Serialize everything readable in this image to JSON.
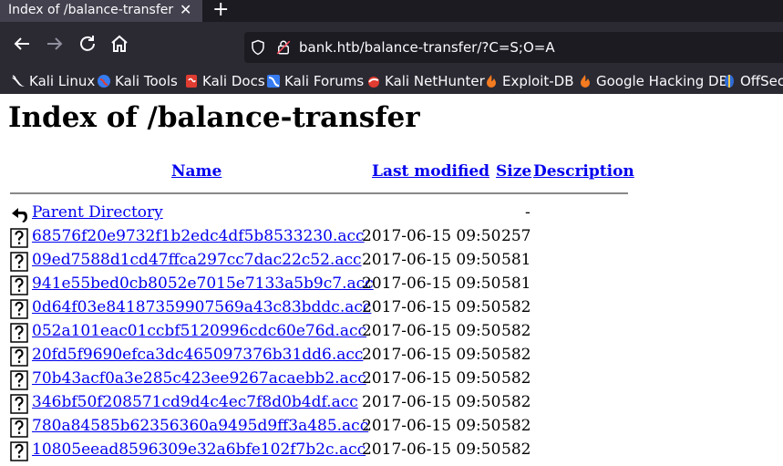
{
  "tab": {
    "title": "Index of /balance-transfer",
    "close_glyph": "✕",
    "new_tab_glyph": "+"
  },
  "nav": {
    "url": "bank.htb/balance-transfer/?C=S;O=A",
    "icons": [
      "back-icon",
      "forward-icon",
      "reload-icon",
      "home-icon",
      "shield-icon",
      "lock-icon"
    ]
  },
  "bookmarks": [
    {
      "label": "Kali Linux",
      "icon": "kali-dragon-icon"
    },
    {
      "label": "Kali Tools",
      "icon": "kali-tools-icon"
    },
    {
      "label": "Kali Docs",
      "icon": "kali-docs-icon"
    },
    {
      "label": "Kali Forums",
      "icon": "kali-forums-icon"
    },
    {
      "label": "Kali NetHunter",
      "icon": "kali-nethunter-icon"
    },
    {
      "label": "Exploit-DB",
      "icon": "exploit-db-icon"
    },
    {
      "label": "Google Hacking DB",
      "icon": "ghdb-icon"
    },
    {
      "label": "OffSec",
      "icon": "offsec-icon"
    }
  ],
  "page": {
    "title": "Index of /balance-transfer",
    "columns": {
      "name": "Name",
      "modified": "Last modified",
      "size": "Size",
      "description": "Description"
    },
    "parent": {
      "name": "Parent Directory",
      "size": "-"
    },
    "files": [
      {
        "name": "68576f20e9732f1b2edc4df5b8533230.acc",
        "modified": "2017-06-15 09:50",
        "size": "257"
      },
      {
        "name": "09ed7588d1cd47ffca297cc7dac22c52.acc",
        "modified": "2017-06-15 09:50",
        "size": "581"
      },
      {
        "name": "941e55bed0cb8052e7015e7133a5b9c7.acc",
        "modified": "2017-06-15 09:50",
        "size": "581"
      },
      {
        "name": "0d64f03e84187359907569a43c83bddc.acc",
        "modified": "2017-06-15 09:50",
        "size": "582"
      },
      {
        "name": "052a101eac01ccbf5120996cdc60e76d.acc",
        "modified": "2017-06-15 09:50",
        "size": "582"
      },
      {
        "name": "20fd5f9690efca3dc465097376b31dd6.acc",
        "modified": "2017-06-15 09:50",
        "size": "582"
      },
      {
        "name": "70b43acf0a3e285c423ee9267acaebb2.acc",
        "modified": "2017-06-15 09:50",
        "size": "582"
      },
      {
        "name": "346bf50f208571cd9d4c4ec7f8d0b4df.acc",
        "modified": "2017-06-15 09:50",
        "size": "582"
      },
      {
        "name": "780a84585b62356360a9495d9ff3a485.acc",
        "modified": "2017-06-15 09:50",
        "size": "582"
      },
      {
        "name": "10805eead8596309e32a6bfe102f7b2c.acc",
        "modified": "2017-06-15 09:50",
        "size": "582"
      }
    ]
  }
}
